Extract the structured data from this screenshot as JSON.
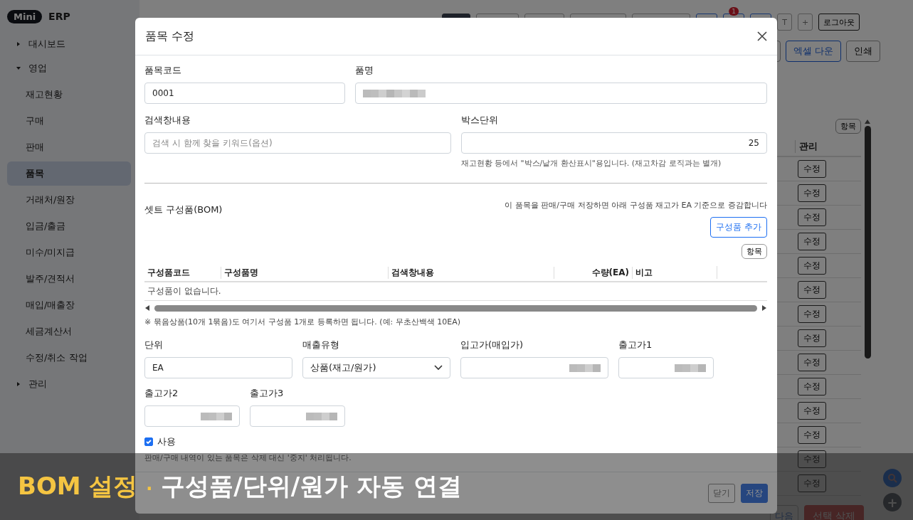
{
  "logo": {
    "badge": "Mini",
    "text": "ERP"
  },
  "sidebar": {
    "items": [
      {
        "label": "대시보드",
        "expanded": false,
        "selected": false
      },
      {
        "label": "영업",
        "expanded": true,
        "selected": false,
        "children": [
          {
            "label": "재고현황",
            "selected": false
          },
          {
            "label": "구매",
            "selected": false
          },
          {
            "label": "판매",
            "selected": false
          },
          {
            "label": "품목",
            "selected": true
          },
          {
            "label": "거래처/원장",
            "selected": false
          },
          {
            "label": "입금/출금",
            "selected": false
          },
          {
            "label": "미수/미지급",
            "selected": false
          },
          {
            "label": "발주/견적서",
            "selected": false
          },
          {
            "label": "매입/매출장",
            "selected": false
          },
          {
            "label": "세금계산서",
            "selected": false
          },
          {
            "label": "수정/취소 작업",
            "selected": false
          }
        ]
      },
      {
        "label": "관리",
        "expanded": false,
        "selected": false
      }
    ]
  },
  "header_buttons": [
    {
      "kind": "dark"
    },
    {
      "kind": "outline"
    },
    {
      "kind": "outline"
    },
    {
      "kind": "outline"
    },
    {
      "kind": "outline"
    },
    {
      "kind": "primary"
    },
    {
      "kind": "primary",
      "badge": "1"
    },
    {
      "kind": "primary"
    },
    {
      "kind": "outline",
      "label": "T"
    },
    {
      "kind": "outline",
      "label": "+"
    },
    {
      "kind": "dark-outline",
      "label": "로그아웃"
    }
  ],
  "toolbar_buttons": [
    {
      "kind": "outline"
    },
    {
      "kind": "primary",
      "label": "엑셀 다운"
    },
    {
      "kind": "outline",
      "label": "인쇄"
    }
  ],
  "list": {
    "columns_button": "항목",
    "column": "관리",
    "row_buttons": [
      "수정",
      "수정",
      "수정",
      "수정",
      "수정",
      "수정",
      "수정",
      "수정",
      "수정",
      "수정",
      "수정",
      "수정",
      "수정",
      "수정"
    ],
    "next_button": "다음",
    "delete_button": "선택 삭제",
    "fab_add": "+"
  },
  "dialog": {
    "title": "품목 수정",
    "top_rows": [
      [
        {
          "label": "품목코드",
          "kind": "text",
          "value": "0001"
        },
        {
          "label": "품명",
          "kind": "text",
          "redacted": true
        }
      ],
      [
        {
          "label": "검색창내용",
          "kind": "text",
          "placeholder": "검색 시 함께 찾을 키워드(옵션)"
        },
        {
          "label": "박스단위",
          "kind": "number",
          "value": "25",
          "help": "재고현황 등에서 \"박스/낱개 환산표시\"용입니다. (재고차감 로직과는 별개)"
        }
      ]
    ],
    "bom": {
      "title": "셋트 구성품(BOM)",
      "note": "이 품목을 판매/구매 저장하면 아래 구성품 재고가 EA 기준으로 증감합니다",
      "add_button": "구성품 추가",
      "columns_button": "항목",
      "columns": [
        {
          "label": "구성품코드"
        },
        {
          "label": "구성품명"
        },
        {
          "label": "검색창내용"
        },
        {
          "label": "수량(EA)"
        },
        {
          "label": "비고"
        }
      ],
      "empty_text": "구성품이 없습니다.",
      "hint": "※ 묶음상품(10개 1묶음)도 여기서 구성품 1개로 등록하면 됩니다. (예: 무초산백색 10EA)"
    },
    "bottom_rows": [
      [
        {
          "label": "단위",
          "kind": "text",
          "value": "EA"
        },
        {
          "label": "매출유형",
          "kind": "select",
          "value": "상품(재고/원가)"
        },
        {
          "label": "입고가(매입가)",
          "kind": "number",
          "redacted": true
        },
        {
          "label": "출고가1",
          "kind": "number",
          "redacted": true
        }
      ],
      [
        {
          "label": "출고가2",
          "kind": "number",
          "redacted": true
        },
        {
          "label": "출고가3",
          "kind": "number",
          "redacted": true
        }
      ]
    ],
    "use": {
      "label": "사용",
      "checked": true
    },
    "delete_note": "판매/구매 내역이 있는 품목은 삭제 대신 '중지' 처리됩니다.",
    "buttons": [
      {
        "label": "닫기",
        "kind": "secondary"
      },
      {
        "label": "저장",
        "kind": "primary"
      }
    ]
  },
  "caption": {
    "highlight": "BOM 설정",
    "separator": "·",
    "text": "구성품/단위/원가 자동 연결"
  }
}
